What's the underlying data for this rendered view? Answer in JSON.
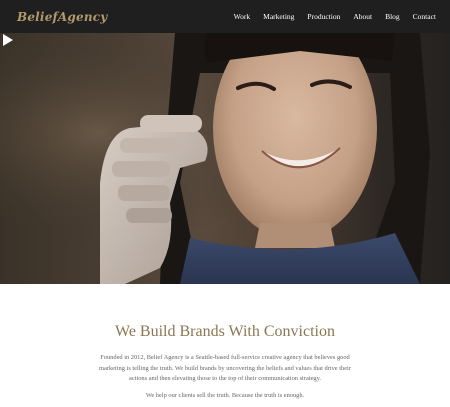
{
  "header": {
    "logo_text": "BeliefAgency",
    "nav": [
      "Work",
      "Marketing",
      "Production",
      "About",
      "Blog",
      "Contact"
    ]
  },
  "hero": {
    "play_icon": "play-icon"
  },
  "content": {
    "headline": "We Build Brands With Conviction",
    "intro": "Founded in 2012, Belief Agency is a Seattle-based full-service creative agency that believes good marketing is telling the truth. We build brands by uncovering the beliefs and values that drive their actions and then elevating those to the top of their communication strategy.",
    "tagline": "We help our clients sell the truth. Because the truth is enough."
  },
  "colors": {
    "header_bg": "#1f1f1f",
    "accent_gold": "#8a7752",
    "logo_gold": "#b09a6c",
    "body_text": "#666666"
  }
}
